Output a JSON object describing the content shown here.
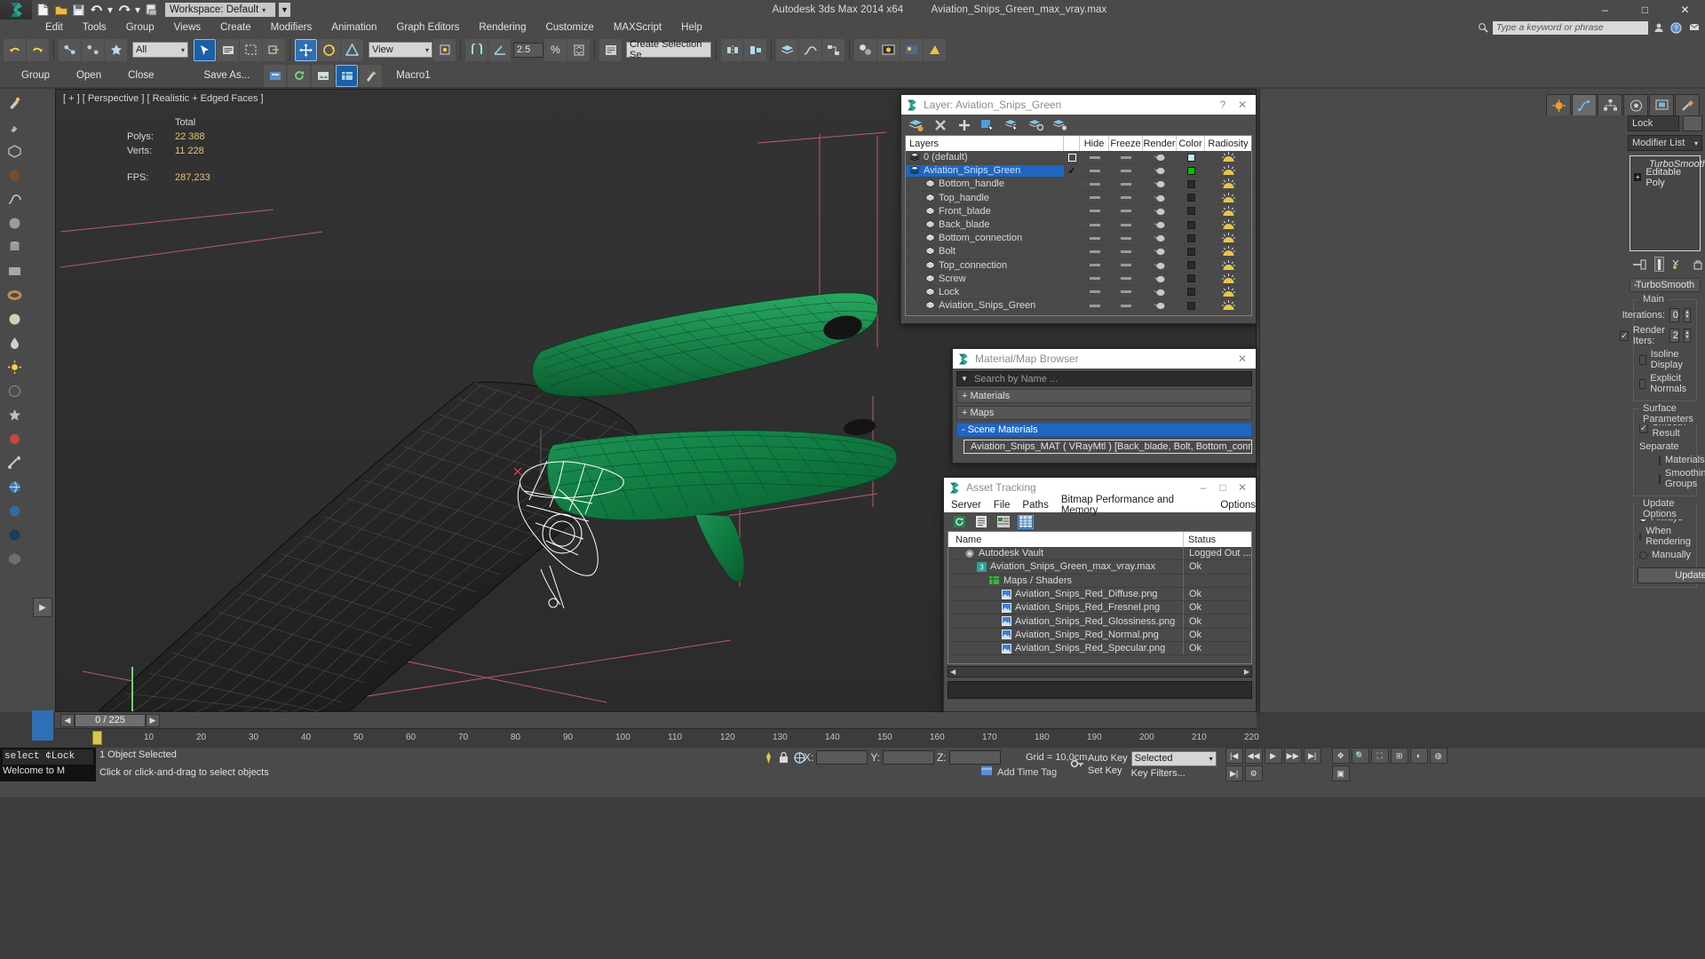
{
  "titlebar": {
    "workspace": "Workspace: Default",
    "app_title": "Autodesk 3ds Max  2014 x64",
    "file_title": "Aviation_Snips_Green_max_vray.max",
    "minimize": "–",
    "maximize": "□",
    "close": "✕"
  },
  "menu": {
    "items": [
      "Edit",
      "Tools",
      "Group",
      "Views",
      "Create",
      "Modifiers",
      "Animation",
      "Graph Editors",
      "Rendering",
      "Customize",
      "MAXScript",
      "Help"
    ],
    "keyword_placeholder": "Type a keyword or phrase"
  },
  "toolbar": {
    "selection_filter": "All",
    "view_combo": "View",
    "angle_value": "2.5",
    "named_selection": "Create Selection Se"
  },
  "toolbar2": {
    "group": "Group",
    "open": "Open",
    "close": "Close",
    "save_as": "Save As...",
    "macro": "Macro1"
  },
  "viewport": {
    "label": "[ + ] [ Perspective ] [ Realistic + Edged Faces ]",
    "stats": {
      "total_header": "Total",
      "polys_label": "Polys:",
      "polys_value": "22 388",
      "verts_label": "Verts:",
      "verts_value": "11 228",
      "fps_label": "FPS:",
      "fps_value": "287,233"
    }
  },
  "layer_dialog": {
    "title": "Layer: Aviation_Snips_Green",
    "help": "?",
    "close": "✕",
    "columns": [
      "Layers",
      "Hide",
      "Freeze",
      "Render",
      "Color",
      "Radiosity"
    ],
    "rows": [
      {
        "name": "0 (default)",
        "indent": 0,
        "selected": false,
        "check": "box",
        "color": "#bfe8ee"
      },
      {
        "name": "Aviation_Snips_Green",
        "indent": 0,
        "selected": true,
        "check": "tick",
        "color": "#00c000"
      },
      {
        "name": "Bottom_handle",
        "indent": 1,
        "selected": false,
        "check": "",
        "color": "#2a2a2a"
      },
      {
        "name": "Top_handle",
        "indent": 1,
        "selected": false,
        "check": "",
        "color": "#2a2a2a"
      },
      {
        "name": "Front_blade",
        "indent": 1,
        "selected": false,
        "check": "",
        "color": "#2a2a2a"
      },
      {
        "name": "Back_blade",
        "indent": 1,
        "selected": false,
        "check": "",
        "color": "#2a2a2a"
      },
      {
        "name": "Bottom_connection",
        "indent": 1,
        "selected": false,
        "check": "",
        "color": "#2a2a2a"
      },
      {
        "name": "Bolt",
        "indent": 1,
        "selected": false,
        "check": "",
        "color": "#2a2a2a"
      },
      {
        "name": "Top_connection",
        "indent": 1,
        "selected": false,
        "check": "",
        "color": "#2a2a2a"
      },
      {
        "name": "Screw",
        "indent": 1,
        "selected": false,
        "check": "",
        "color": "#2a2a2a"
      },
      {
        "name": "Lock",
        "indent": 1,
        "selected": false,
        "check": "",
        "color": "#2a2a2a"
      },
      {
        "name": "Aviation_Snips_Green",
        "indent": 1,
        "selected": false,
        "check": "",
        "color": "#2a2a2a"
      }
    ]
  },
  "material_browser": {
    "title": "Material/Map Browser",
    "close": "✕",
    "search_placeholder": "Search by Name ...",
    "groups": [
      {
        "label": "+ Materials",
        "open": false
      },
      {
        "label": "+ Maps",
        "open": false
      },
      {
        "label": "- Scene Materials",
        "open": true
      }
    ],
    "scene_material": "Aviation_Snips_MAT ( VRayMtl ) [Back_blade, Bolt, Bottom_connecti..."
  },
  "asset_tracking": {
    "title": "Asset Tracking",
    "minimize": "–",
    "maximize": "□",
    "close": "✕",
    "menu": [
      "Server",
      "File",
      "Paths",
      "Bitmap Performance and Memory",
      "Options"
    ],
    "columns": [
      "Name",
      "Status"
    ],
    "rows": [
      {
        "name": "Autodesk Vault",
        "status": "Logged Out ...",
        "indent": 1,
        "icon": "vault"
      },
      {
        "name": "Aviation_Snips_Green_max_vray.max",
        "status": "Ok",
        "indent": 2,
        "icon": "max"
      },
      {
        "name": "Maps / Shaders",
        "status": "",
        "indent": 3,
        "icon": "maps"
      },
      {
        "name": "Aviation_Snips_Red_Diffuse.png",
        "status": "Ok",
        "indent": 4,
        "icon": "png"
      },
      {
        "name": "Aviation_Snips_Red_Fresnel.png",
        "status": "Ok",
        "indent": 4,
        "icon": "png"
      },
      {
        "name": "Aviation_Snips_Red_Glossiness.png",
        "status": "Ok",
        "indent": 4,
        "icon": "png"
      },
      {
        "name": "Aviation_Snips_Red_Normal.png",
        "status": "Ok",
        "indent": 4,
        "icon": "png"
      },
      {
        "name": "Aviation_Snips_Red_Specular.png",
        "status": "Ok",
        "indent": 4,
        "icon": "png"
      }
    ]
  },
  "command_panel": {
    "lock_label": "Lock",
    "modifier_list": "Modifier List",
    "stack": [
      {
        "label": "TurboSmooth",
        "italic": true
      },
      {
        "label": "Editable Poly",
        "italic": false
      }
    ],
    "rollout_title": "TurboSmooth",
    "rollout_minus": "-",
    "main_group": "Main",
    "iterations_label": "Iterations:",
    "iterations_value": "0",
    "render_iters_label": "Render Iters:",
    "render_iters_value": "2",
    "render_iters_checked": true,
    "isoline_label": "Isoline Display",
    "explicit_normals_label": "Explicit Normals",
    "surface_params_group": "Surface Parameters",
    "smooth_result_label": "Smooth Result",
    "smooth_result_checked": true,
    "separate_label": "Separate",
    "separate_materials": "Materials",
    "separate_smoothing": "Smoothing Groups",
    "update_options_group": "Update Options",
    "update_always": "Always",
    "update_when_rendering": "When Rendering",
    "update_manually": "Manually",
    "update_button": "Update"
  },
  "timebar": {
    "current_frame": "0 / 225",
    "ticks": [
      "10",
      "20",
      "30",
      "40",
      "50",
      "60",
      "70",
      "80",
      "90",
      "100",
      "110",
      "120",
      "130",
      "140",
      "150",
      "160",
      "170",
      "180",
      "190",
      "200",
      "210",
      "220"
    ]
  },
  "statusbar": {
    "overlay_line1": "select ¢Lock",
    "overlay_line2": "Welcome to M",
    "selection_text": "1 Object Selected",
    "prompt": "Click or click-and-drag to select objects",
    "x_label": "X:",
    "y_label": "Y:",
    "z_label": "Z:",
    "x_value": "",
    "y_value": "",
    "z_value": "",
    "grid_text": "Grid = 10,0cm",
    "auto_key": "Auto Key",
    "set_key": "Set Key",
    "selected_combo": "Selected",
    "key_filters": "Key Filters...",
    "add_time_tag": "Add Time Tag"
  }
}
